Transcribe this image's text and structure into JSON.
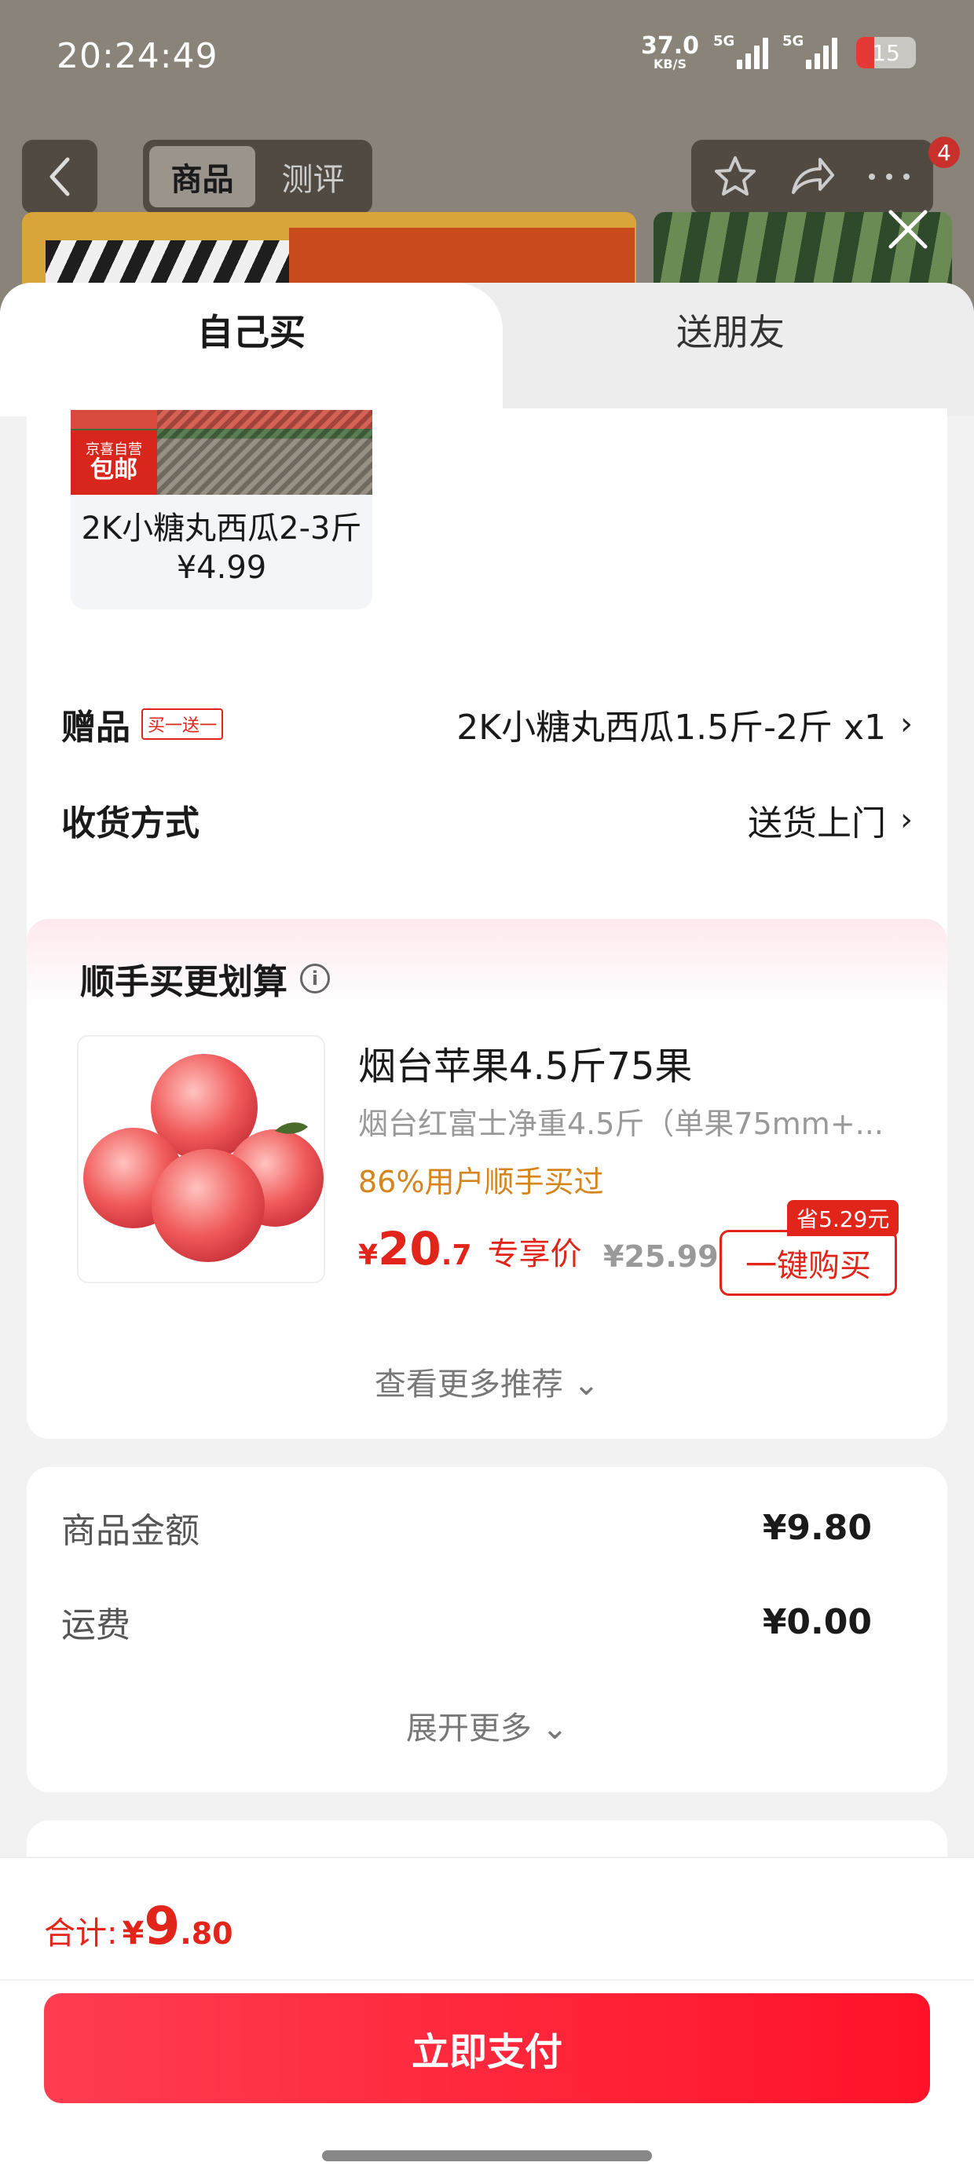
{
  "status_bar": {
    "time": "20:24:49",
    "net_speed": "37.0",
    "net_unit": "KB/S",
    "signal1": "5G",
    "signal2": "5G",
    "battery": "15"
  },
  "nav": {
    "tabs": [
      "商品",
      "测评"
    ],
    "badge": "4"
  },
  "sheet_tabs": {
    "self": "自己买",
    "gift": "送朋友"
  },
  "product": {
    "tag_small": "京喜自营",
    "tag_big": "包邮",
    "title": "2K小糖丸西瓜2-3斤 ¥4.99"
  },
  "gift": {
    "label": "赠品",
    "tag": "买一送一",
    "value": "2K小糖丸西瓜1.5斤-2斤 x1"
  },
  "delivery": {
    "label": "收货方式",
    "value": "送货上门"
  },
  "recommend": {
    "title": "顺手买更划算",
    "name": "烟台苹果4.5斤75果",
    "desc": "烟台红富士净重4.5斤（单果75mm+...",
    "social": "86%用户顺手买过",
    "price_cur": "¥",
    "price_int": "20",
    "price_dec": ".7",
    "price_label": "专享价",
    "orig_price": "¥25.99",
    "save": "省5.29元",
    "buy_label": "一键购买",
    "more": "查看更多推荐"
  },
  "summary": {
    "goods_label": "商品金额",
    "goods_value": "¥9.80",
    "shipping_label": "运费",
    "shipping_value": "¥0.00",
    "expand": "展开更多"
  },
  "footer": {
    "total_label": "合计:",
    "total_cur": "¥",
    "total_int": "9",
    "total_dec": ".80",
    "pay": "立即支付"
  },
  "colors": {
    "accent": "#e1251b",
    "social": "#d6841c"
  }
}
